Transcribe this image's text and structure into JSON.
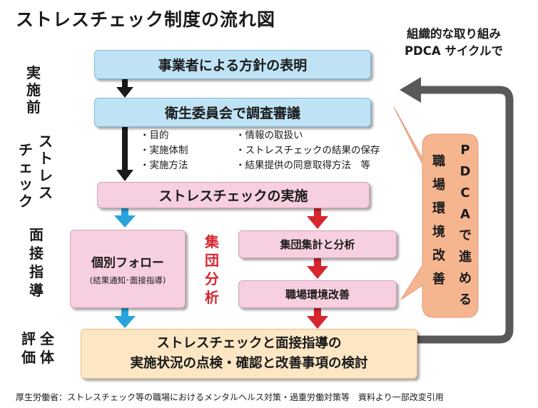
{
  "title": "ストレスチェック制度の流れ図",
  "side_labels": {
    "pre": [
      "実",
      "施",
      "前"
    ],
    "stress_check_col1": [
      "ス",
      "ト",
      "レ",
      "ス"
    ],
    "stress_check_col2": [
      "チ",
      "ェ",
      "ッ",
      "ク"
    ],
    "interview": [
      "面",
      "接",
      "指",
      "導"
    ],
    "overall_col1": [
      "全",
      "体"
    ],
    "overall_col2": [
      "評",
      "価"
    ]
  },
  "boxes": {
    "policy": "事業者による方針の表明",
    "committee": "衛生委員会で調査審議",
    "implementation": "ストレスチェックの実施",
    "individual_title": "個別フォロー",
    "individual_sub": "(結果通知･面接指導)",
    "group_calc": "集団集計と分析",
    "workplace": "職場環境改善",
    "final_line1": "ストレスチェックと面接指導の",
    "final_line2": "実施状況の点検・確認と改善事項の検討"
  },
  "deliberation_items": {
    "left": [
      "・目的",
      "・実施体制",
      "・実施方法"
    ],
    "right": [
      "・情報の取扱い",
      "・ストレスチェックの結果の保存",
      "・結果提供の同意取得方法　等"
    ]
  },
  "group_analysis_label": [
    "集",
    "団",
    "分",
    "析"
  ],
  "pdca_note": {
    "line1": "組織的な取り組み",
    "line2": "PDCA サイクルで"
  },
  "pdca_callout": {
    "col1": [
      "P",
      "D",
      "C",
      "A",
      "で",
      "進",
      "め",
      "る"
    ],
    "col2": [
      "職",
      "場",
      "環",
      "境",
      "改",
      "善"
    ]
  },
  "footnote": "厚生労働省：ストレスチェック等の職場におけるメンタルヘルス対策・過重労働対策等　資料より一部改変引用",
  "colors": {
    "blue_box": "#bfe3f5",
    "pink_box": "#f6cfe0",
    "cream_box": "#fce6c3",
    "callout": "#f5b58f",
    "arrow_black": "#1a1a1a",
    "arrow_blue": "#2aa3dc",
    "arrow_red": "#d7262e",
    "loop_gray": "#595959"
  }
}
